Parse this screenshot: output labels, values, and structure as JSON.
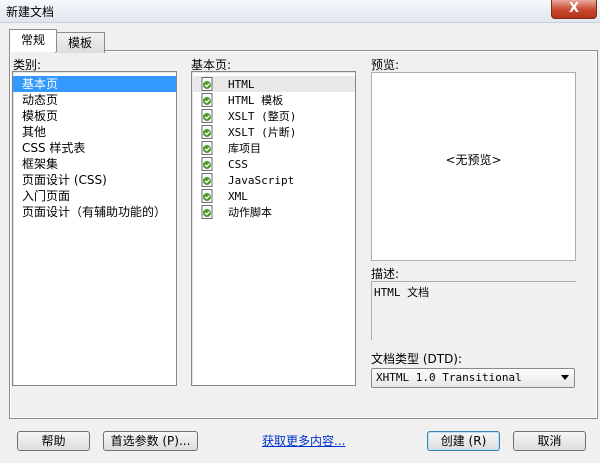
{
  "window": {
    "title": "新建文档",
    "close_glyph": "X"
  },
  "tabs": [
    {
      "label": "常规",
      "active": true
    },
    {
      "label": "模板",
      "active": false
    }
  ],
  "category": {
    "label": "类别:",
    "items": [
      {
        "label": "基本页",
        "selected": true
      },
      {
        "label": "动态页"
      },
      {
        "label": "模板页"
      },
      {
        "label": "其他"
      },
      {
        "label": "CSS 样式表"
      },
      {
        "label": "框架集"
      },
      {
        "label": "页面设计 (CSS)"
      },
      {
        "label": "入门页面"
      },
      {
        "label": "页面设计（有辅助功能的）"
      }
    ]
  },
  "basic_page": {
    "label": "基本页:",
    "items": [
      {
        "label": "HTML",
        "selected": true,
        "icon": "document-icon"
      },
      {
        "label": "HTML 模板",
        "icon": "document-icon"
      },
      {
        "label": "XSLT (整页)",
        "icon": "document-icon"
      },
      {
        "label": "XSLT (片断)",
        "icon": "document-icon"
      },
      {
        "label": "库项目",
        "icon": "document-icon"
      },
      {
        "label": "CSS",
        "icon": "document-icon"
      },
      {
        "label": "JavaScript",
        "icon": "document-icon"
      },
      {
        "label": "XML",
        "icon": "document-icon"
      },
      {
        "label": "动作脚本",
        "icon": "document-icon"
      }
    ]
  },
  "preview": {
    "label": "预览:",
    "placeholder": "<无预览>"
  },
  "description": {
    "label": "描述:",
    "text": "HTML 文档"
  },
  "doctype": {
    "label": "文档类型 (DTD):",
    "value": "XHTML 1.0 Transitional"
  },
  "buttons": {
    "help": "帮助",
    "preferences": "首选参数 (P)...",
    "more_content": "获取更多内容...",
    "create": "创建 (R)",
    "cancel": "取消"
  },
  "colors": {
    "selection": "#3399ff",
    "link": "#0033cc",
    "close_button": "#c7482f"
  }
}
